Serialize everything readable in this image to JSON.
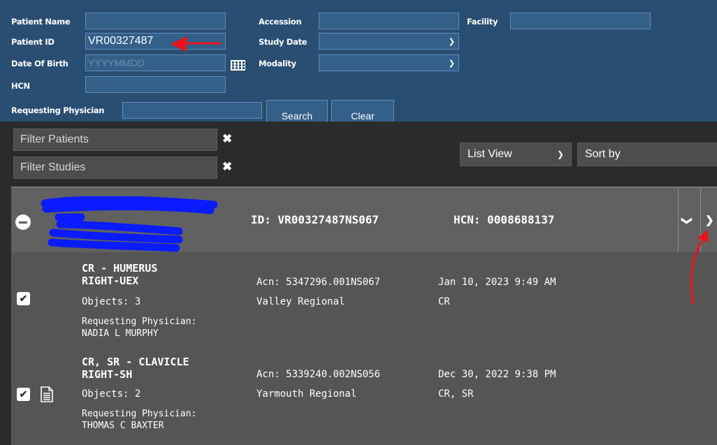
{
  "search": {
    "patient_name_label": "Patient Name",
    "patient_name_value": "",
    "patient_id_label": "Patient ID",
    "patient_id_value": "VR00327487",
    "dob_label": "Date Of Birth",
    "dob_placeholder": "YYYYMMDD",
    "hcn_label": "HCN",
    "hcn_value": "",
    "requesting_physician_label": "Requesting Physician",
    "requesting_physician_value": "",
    "accession_label": "Accession",
    "accession_value": "",
    "study_date_label": "Study Date",
    "study_date_value": "",
    "modality_label": "Modality",
    "modality_value": "",
    "facility_label": "Facility",
    "facility_value": "",
    "search_button": "Search",
    "clear_button": "Clear"
  },
  "filters": {
    "filter_patients_placeholder": "Filter Patients",
    "filter_studies_placeholder": "Filter Studies",
    "view_select": "List View",
    "sort_select": "Sort by"
  },
  "patient": {
    "id_text": "ID: VR00327487NS067",
    "hcn_text": "HCN: 0008688137"
  },
  "studies": [
    {
      "description_line1": "CR - HUMERUS",
      "description_line2": "RIGHT-UEX",
      "objects": "Objects: 3",
      "physician_label": "Requesting Physician:",
      "physician": "NADIA L MURPHY",
      "accession": "Acn: 5347296.001NS067",
      "facility": "Valley Regional",
      "date": "Jan 10, 2023 9:49 AM",
      "modality": "CR",
      "checked": true
    },
    {
      "description_line1": "CR, SR - CLAVICLE",
      "description_line2": "RIGHT-SH",
      "objects": "Objects: 2",
      "physician_label": "Requesting Physician:",
      "physician": "THOMAS C BAXTER",
      "accession": "Acn: 5339240.002NS056",
      "facility": "Yarmouth Regional",
      "date": "Dec 30, 2022 9:38 PM",
      "modality": "CR, SR",
      "checked": true
    }
  ],
  "colors": {
    "header_bg": "#2a4d72",
    "field_bg": "#335f89",
    "annotation_red": "#e8141c",
    "redaction_blue": "#0a1bff"
  },
  "icons": [
    "calendar-icon",
    "chevron-down-icon",
    "chevron-right-icon",
    "close-icon",
    "document-icon",
    "minus-circle-icon",
    "checkmark-icon"
  ]
}
